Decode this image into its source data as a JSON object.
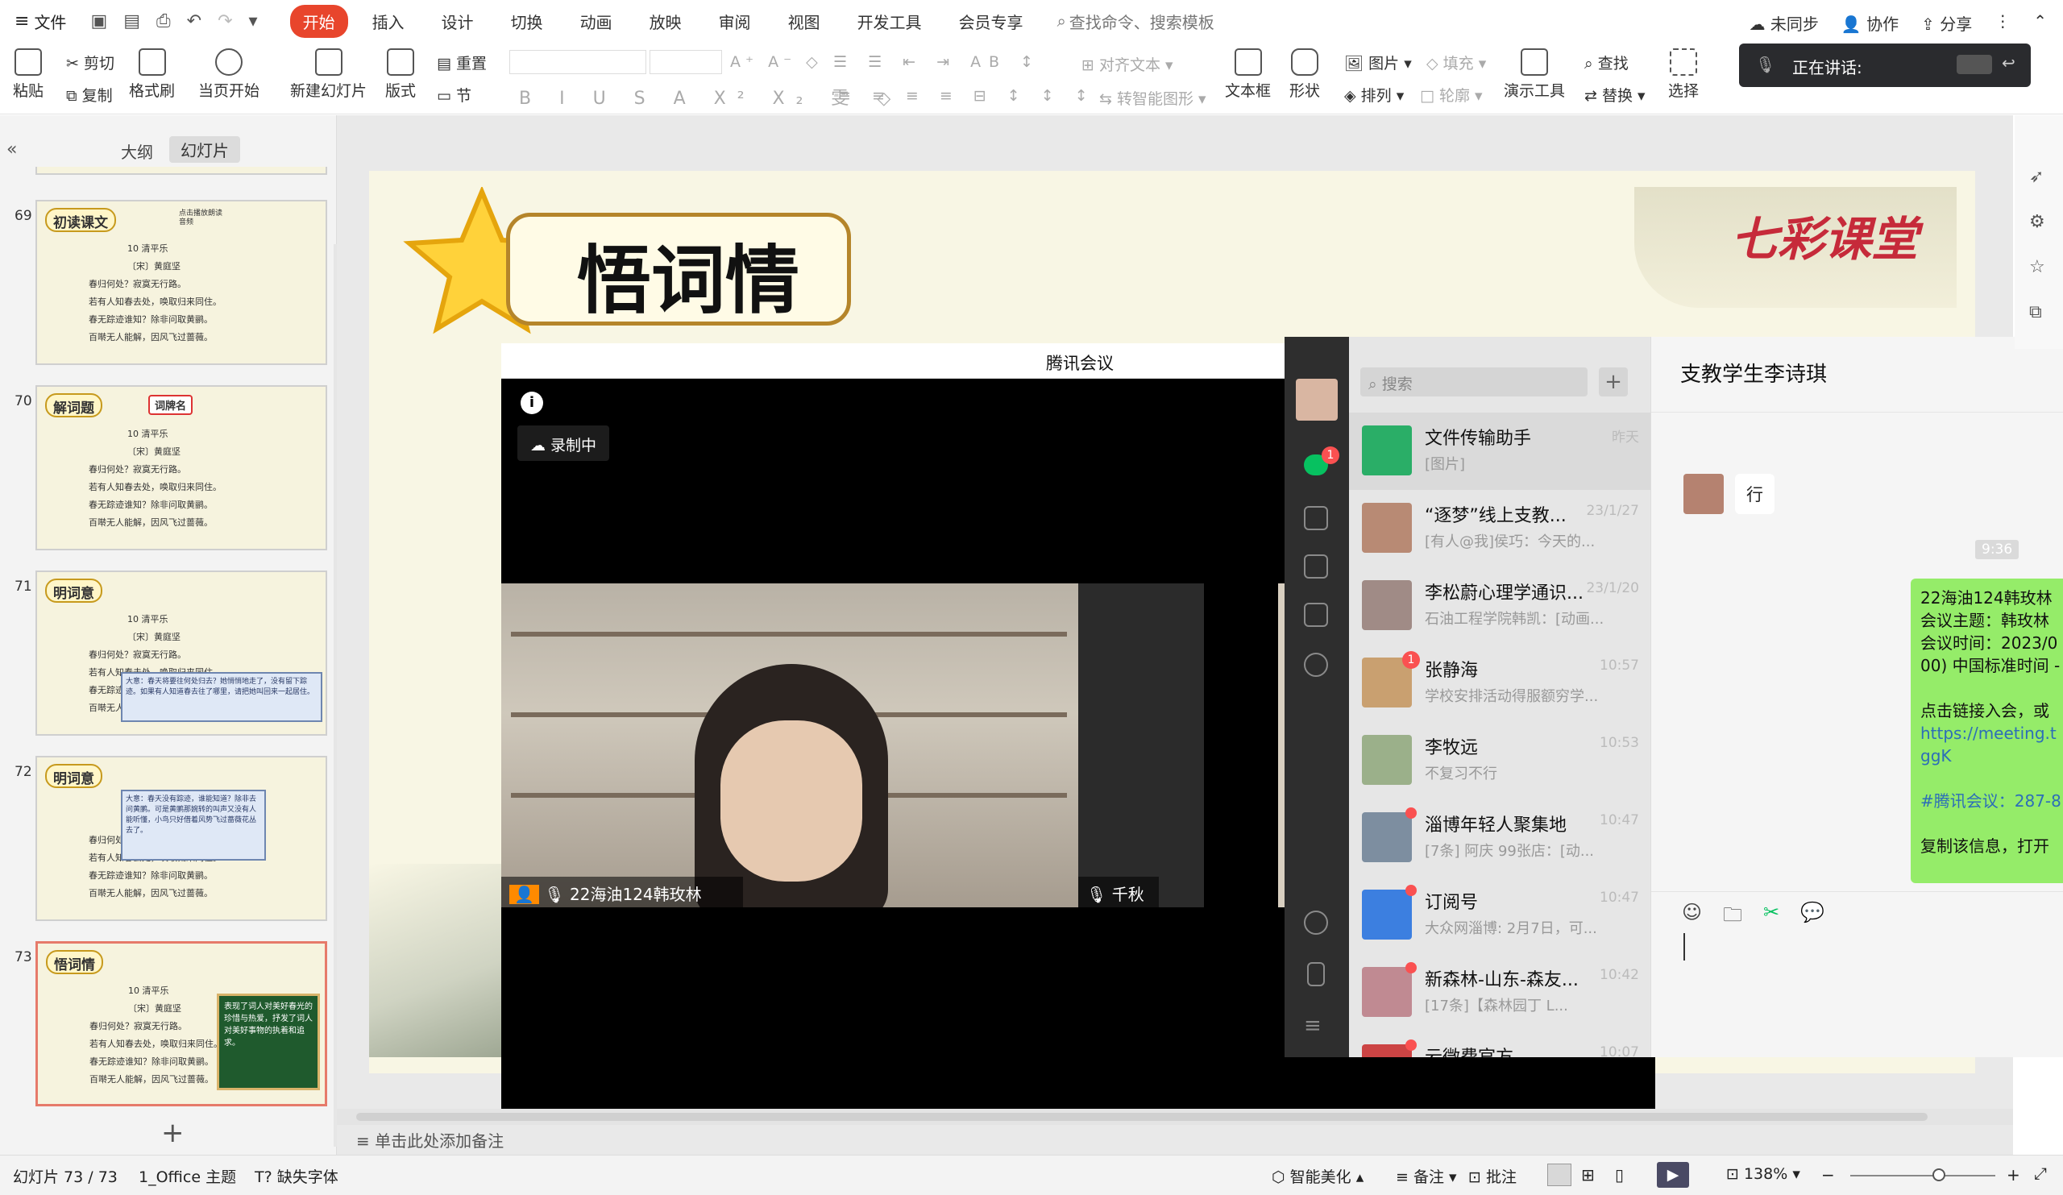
{
  "menubar": {
    "file": "文件",
    "tabs": [
      "开始",
      "插入",
      "设计",
      "切换",
      "动画",
      "放映",
      "审阅",
      "视图",
      "开发工具",
      "会员专享"
    ],
    "search": "查找命令、搜索模板",
    "right": {
      "sync": "未同步",
      "collab": "协作",
      "share": "分享"
    }
  },
  "ribbon": {
    "paste": "粘贴",
    "cut": "剪切",
    "copy": "复制",
    "format_painter": "格式刷",
    "play_current": "当页开始",
    "new_slide": "新建幻灯片",
    "layout": "版式",
    "reset": "重置",
    "section": "节",
    "align_text": "对齐文本",
    "smart_graphic": "转智能图形",
    "textbox": "文本框",
    "shape": "形状",
    "picture": "图片",
    "fill": "填充",
    "arrange": "排列",
    "outline": "轮廓",
    "present_tool": "演示工具",
    "find": "查找",
    "replace": "替换",
    "select": "选择",
    "speaking": "正在讲话:"
  },
  "leftpanel": {
    "tab_outline": "大纲",
    "tab_slides": "幻灯片",
    "slides": [
      {
        "num": "69",
        "title": "初读课文",
        "note": "点击播放朗读音频"
      },
      {
        "num": "70",
        "title": "解词题",
        "tag": "词牌名"
      },
      {
        "num": "71",
        "title": "明词意",
        "note": "大意：春天将要往何处归去？她悄悄地走了，没有留下踪迹。如果有人知道春去往了哪里，请把她叫回来一起居住。"
      },
      {
        "num": "72",
        "title": "明词意",
        "note": "大意：春天没有踪迹，谁能知道？除非去问黄鹂。可是黄鹂那婉转的叫声又没有人能听懂，小鸟只好借着风势飞过蔷薇花丛去了。"
      },
      {
        "num": "73",
        "title": "悟词情",
        "note": "表现了词人对美好春光的珍惜与热爱，抒发了词人对美好事物的执着和追求。"
      }
    ],
    "thumb_text": [
      "10 清平乐",
      "〔宋〕黄庭坚",
      "春归何处？寂寞无行路。",
      "若有人知春去处，唤取归来同住。",
      "春无踪迹谁知？除非问取黄鹂。",
      "百啭无人能解，因风飞过蔷薇。"
    ],
    "add": "+"
  },
  "slide": {
    "title": "悟词情",
    "logo": "七彩课堂"
  },
  "meeting": {
    "title": "腾讯会议",
    "recording": "录制中",
    "participant1": "22海油124韩玫林",
    "participant2": "千秋"
  },
  "wechat": {
    "search_placeholder": "搜索",
    "sidebar_badge": "1",
    "chats": [
      {
        "name": "文件传输助手",
        "preview": "[图片]",
        "time": "昨天",
        "color": "#2aae67"
      },
      {
        "name": "“逐梦”线上支教...",
        "preview": "[有人@我]侯巧：今天的...",
        "time": "23/1/27",
        "color": "#b88a74"
      },
      {
        "name": "李松蔚心理学通识...",
        "preview": "石油工程学院韩凯：[动画...",
        "time": "23/1/20",
        "color": "#a08b86"
      },
      {
        "name": "张静海",
        "preview": "学校安排活动得服额穷学...",
        "time": "10:57",
        "color": "#c9a070",
        "badge": "1"
      },
      {
        "name": "李牧远",
        "preview": "不复习不行",
        "time": "10:53",
        "color": "#9bb08a"
      },
      {
        "name": "淄博年轻人聚集地",
        "preview": "[7条] 阿庆 99张店：[动...",
        "time": "10:47",
        "color": "#7d8ea0"
      },
      {
        "name": "订阅号",
        "preview": "大众网淄博: 2月7日，可...",
        "time": "10:47",
        "color": "#3c7fe0"
      },
      {
        "name": "新森林-山东-森友...",
        "preview": "[17条]【森林园丁 L...",
        "time": "10:42",
        "color": "#c08a92"
      },
      {
        "name": "云微费官方",
        "preview": "",
        "time": "10:07",
        "color": "#cc4444"
      }
    ],
    "chat_title": "支教学生李诗琪",
    "msg_in": "行",
    "time_label": "9:36",
    "msg_out_lines": [
      "22海油124韩玫林 ",
      "会议主题：韩玫林",
      "会议时间：2023/0",
      "00) 中国标准时间 -",
      "",
      "点击链接入会，或",
      "https://meeting.t",
      "ggK",
      "",
      "#腾讯会议：287-8",
      "",
      "复制该信息，打开"
    ]
  },
  "notes": "单击此处添加备注",
  "status": {
    "slide_count": "幻灯片 73 / 73",
    "theme": "1_Office 主题",
    "missing_font": "缺失字体",
    "beautify": "智能美化",
    "notes_btn": "备注",
    "comment": "批注",
    "zoom": "138%"
  },
  "colors": {
    "accent": "#e8452c",
    "wechat_green": "#95ec69",
    "wechat_sidebar": "#2e2e2e"
  }
}
